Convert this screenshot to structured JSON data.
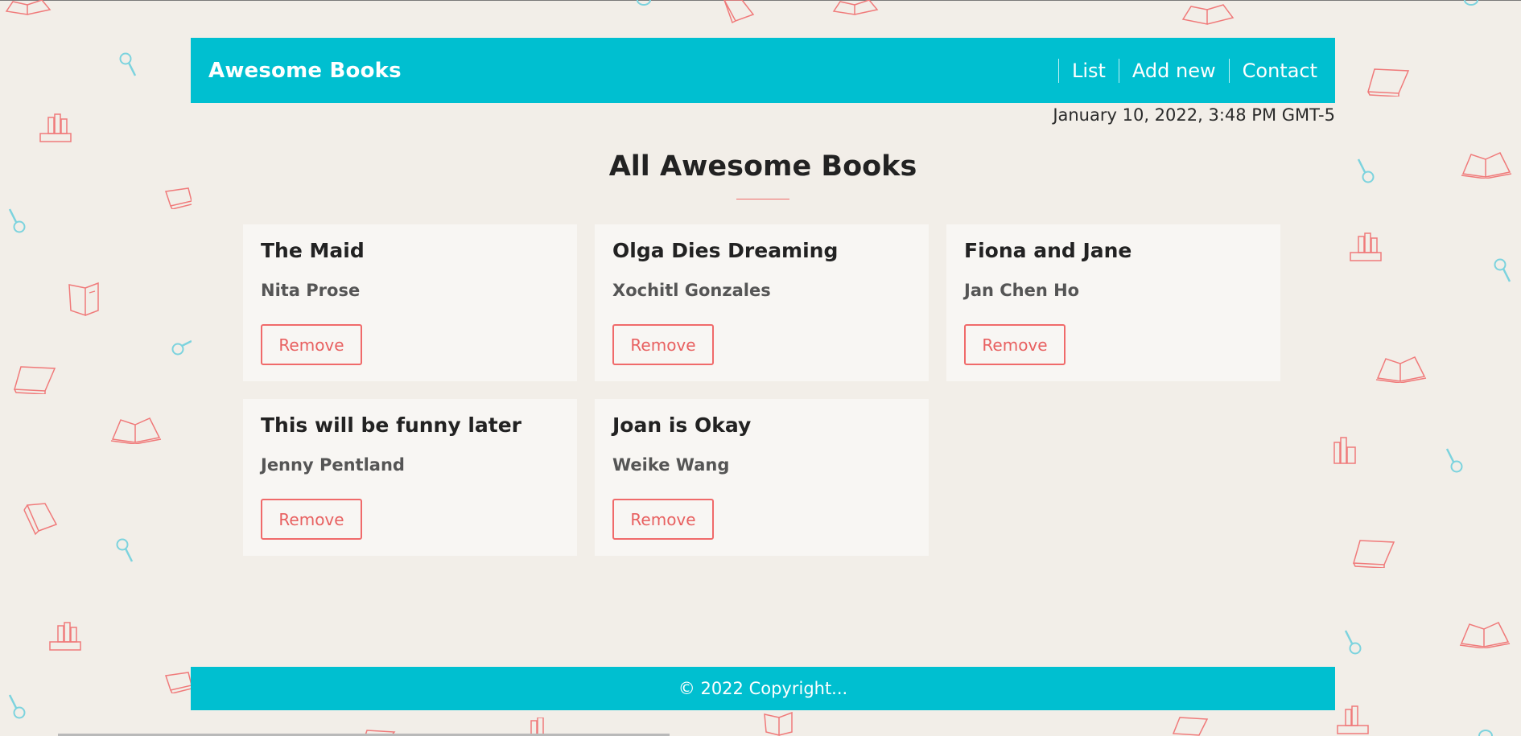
{
  "header": {
    "brand": "Awesome Books",
    "nav": [
      {
        "label": "List"
      },
      {
        "label": "Add new"
      },
      {
        "label": "Contact"
      }
    ]
  },
  "datetime": "January 10, 2022, 3:48 PM GMT-5",
  "main": {
    "title": "All Awesome Books",
    "books": [
      {
        "title": "The Maid",
        "author": "Nita Prose",
        "remove_label": "Remove"
      },
      {
        "title": "Olga Dies Dreaming",
        "author": "Xochitl Gonzales",
        "remove_label": "Remove"
      },
      {
        "title": "Fiona and Jane",
        "author": "Jan Chen Ho",
        "remove_label": "Remove"
      },
      {
        "title": "This will be funny later",
        "author": "Jenny Pentland",
        "remove_label": "Remove"
      },
      {
        "title": "Joan is Okay",
        "author": "Weike Wang",
        "remove_label": "Remove"
      }
    ]
  },
  "footer": {
    "copyright": "© 2022 Copyright..."
  },
  "colors": {
    "accent": "#00bfd0",
    "danger": "#f06a6a",
    "background": "#f2eee8",
    "card": "#f8f6f3"
  }
}
